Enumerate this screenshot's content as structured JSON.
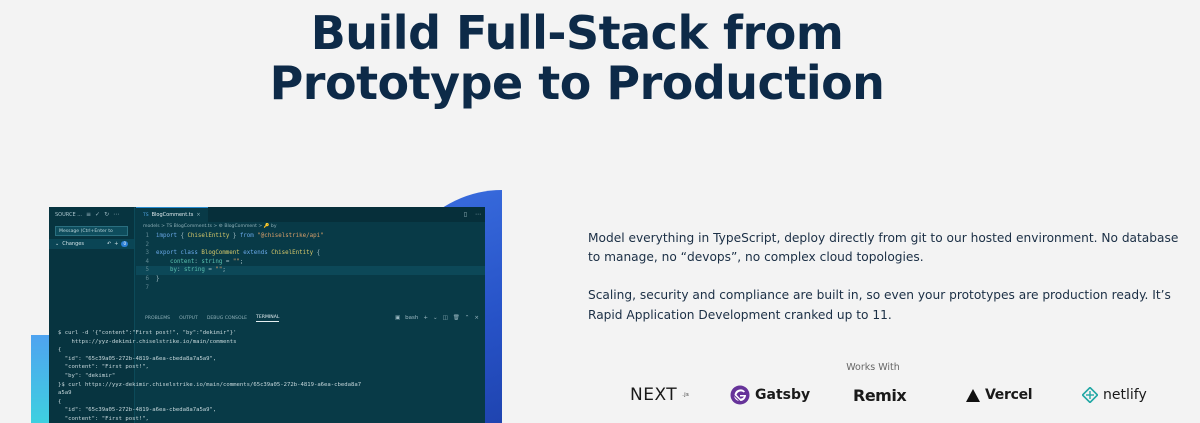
{
  "hero": {
    "title_line1": "Build Full-Stack from",
    "title_line2": "Prototype to Production"
  },
  "ide": {
    "sidebar": {
      "header": "SOURCE ...",
      "message_placeholder": "Message (Ctrl+Enter to",
      "changes_label": "Changes",
      "changes_count": "0"
    },
    "tab": {
      "badge": "TS",
      "label": "BlogComment.ts",
      "close": "×"
    },
    "breadcrumb": "models > TS BlogComment.ts > ⚙ BlogComment > 🔑 by",
    "code": [
      {
        "n": "1",
        "parts": [
          [
            "kw",
            "import"
          ],
          [
            "plain",
            " { "
          ],
          [
            "cls",
            "ChiselEntity"
          ],
          [
            "plain",
            " } "
          ],
          [
            "kw",
            "from"
          ],
          [
            "str",
            " \"@chiselstrike/api\""
          ]
        ]
      },
      {
        "n": "2",
        "parts": []
      },
      {
        "n": "3",
        "parts": [
          [
            "kw",
            "export class "
          ],
          [
            "cls",
            "BlogComment"
          ],
          [
            "kw",
            " extends "
          ],
          [
            "cls",
            "ChiselEntity"
          ],
          [
            "plain",
            " {"
          ]
        ]
      },
      {
        "n": "4",
        "parts": [
          [
            "prop",
            "    content"
          ],
          [
            "plain",
            ": "
          ],
          [
            "type",
            "string"
          ],
          [
            "plain",
            " = "
          ],
          [
            "str",
            "\"\""
          ],
          [
            "plain",
            ";"
          ]
        ]
      },
      {
        "n": "5",
        "parts": [
          [
            "prop",
            "    by"
          ],
          [
            "plain",
            ": "
          ],
          [
            "type",
            "string"
          ],
          [
            "plain",
            " = "
          ],
          [
            "str",
            "\"\""
          ],
          [
            "plain",
            ";"
          ]
        ],
        "hl": true
      },
      {
        "n": "6",
        "parts": [
          [
            "plain",
            "}"
          ]
        ]
      },
      {
        "n": "7",
        "parts": []
      }
    ],
    "panel_tabs": [
      "PROBLEMS",
      "OUTPUT",
      "DEBUG CONSOLE",
      "TERMINAL"
    ],
    "terminal_label": "bash",
    "terminal": [
      "$ curl -d '{\"content\":\"First post!\", \"by\":\"dekimir\"}'",
      "    https://yyz-dekimir.chiselstrike.io/main/comments",
      "{",
      "  \"id\": \"65c39a05-272b-4819-a6ea-cbeda8a7a5a9\",",
      "  \"content\": \"First post!\",",
      "  \"by\": \"dekimir\"",
      "}$ curl https://yyz-dekimir.chiselstrike.io/main/comments/65c39a05-272b-4819-a6ea-cbeda8a7",
      "a5a9",
      "{",
      "  \"id\": \"65c39a05-272b-4819-a6ea-cbeda8a7a5a9\",",
      "  \"content\": \"First post!\","
    ]
  },
  "copy": {
    "p1": "Model everything in TypeScript, deploy directly from git to our hosted environment. No database to manage, no “devops”, no complex cloud topologies.",
    "p2": "Scaling, security and compliance are built in, so even your prototypes are production ready. It’s Rapid Application Development cranked up to 11."
  },
  "works_with": {
    "label": "Works With",
    "logos": {
      "next": "NEXT",
      "next_suffix": ".js",
      "gatsby": "Gatsby",
      "remix": "Remix",
      "vercel": "Vercel",
      "netlify": "netlify"
    }
  },
  "colors": {
    "headline": "#0d2a48",
    "ide_bg": "#083a47",
    "accent_blue": "#2753c8",
    "accent_cyan": "#3ed0e0",
    "gatsby_purple": "#663399",
    "netlify_teal": "#20a7a4"
  }
}
